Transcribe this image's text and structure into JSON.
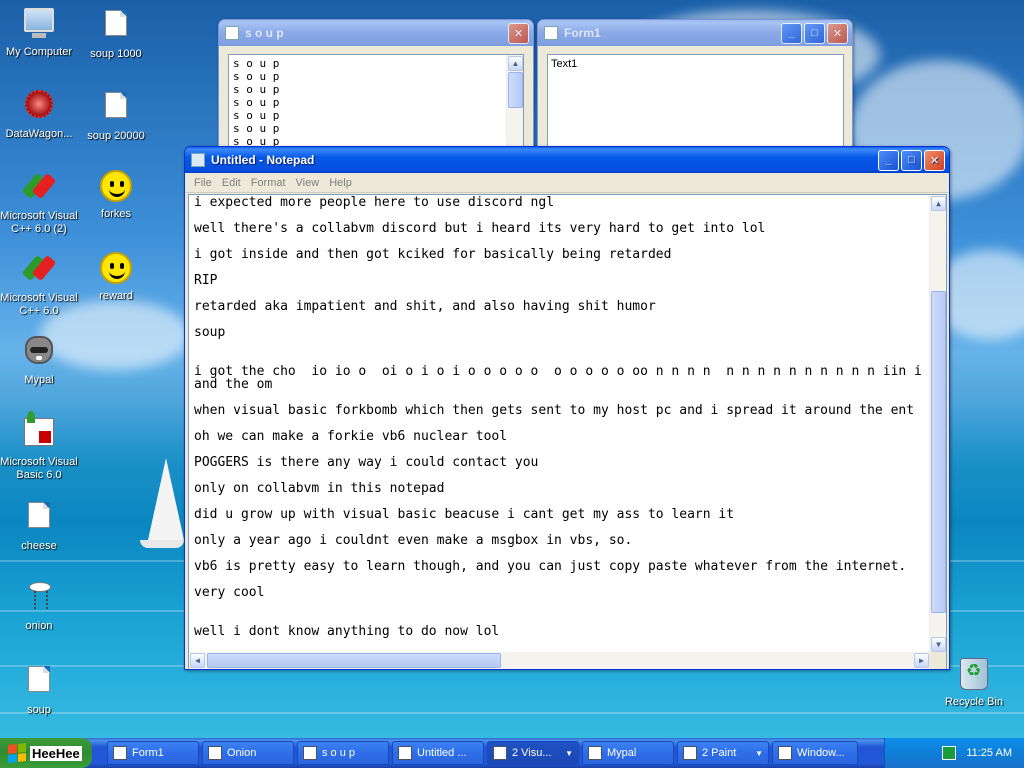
{
  "desktop": {
    "icons": [
      {
        "label": "My Computer",
        "icon": "computer-icon"
      },
      {
        "label": "soup 1000",
        "icon": "file-icon"
      },
      {
        "label": "DataWagon...",
        "icon": "datawagon-icon"
      },
      {
        "label": "soup 20000",
        "icon": "file-icon"
      },
      {
        "label": "Microsoft Visual C++ 6.0 (2)",
        "icon": "visual-cpp-icon"
      },
      {
        "label": "forkes",
        "icon": "smiley-icon"
      },
      {
        "label": "Microsoft Visual C++ 6.0",
        "icon": "visual-cpp-icon"
      },
      {
        "label": "reward",
        "icon": "smiley-icon"
      },
      {
        "label": "Mypal",
        "icon": "raccoon-icon"
      },
      {
        "label": "Microsoft Visual Basic 6.0",
        "icon": "visual-basic-icon"
      },
      {
        "label": "cheese",
        "icon": "file-icon"
      },
      {
        "label": "onion",
        "icon": "onion-icon"
      },
      {
        "label": "soup",
        "icon": "file-icon"
      },
      {
        "label": "Recycle Bin",
        "icon": "recycle-bin-icon"
      }
    ]
  },
  "soup_window": {
    "title": "s o u p",
    "lines": [
      "s o u p",
      "s o u p",
      "s o u p",
      "s o u p",
      "s o u p",
      "s o u p",
      "s o u p"
    ]
  },
  "form1_window": {
    "title": "Form1",
    "textbox_value": "Text1"
  },
  "notepad": {
    "title": "Untitled - Notepad",
    "menu": [
      "File",
      "Edit",
      "Format",
      "View",
      "Help"
    ],
    "lines": [
      "i expected more people here to use discord ngl",
      "well there's a collabvm discord but i heard its very hard to get into lol",
      "i got inside and then got kciked for basically being retarded",
      "RIP",
      "retarded aka impatient and shit, and also having shit humor",
      "soup",
      "i got the cho  io io o  oi o i o i o o o o o  o o o o o oo n n n n  n n n n n n n n n n iin i",
      "and the om",
      "when visual basic forkbomb which then gets sent to my host pc and i spread it around the ent",
      "oh we can make a forkie vb6 nuclear tool",
      "POGGERS is there any way i could contact you",
      "only on collabvm in this notepad",
      "did u grow up with visual basic beacuse i cant get my ass to learn it",
      "only a year ago i couldnt even make a msgbox in vbs, so.",
      "vb6 is pretty easy to learn though, and you can just copy paste whatever from the internet.",
      "very cool",
      "well i dont know anything to do now lol"
    ]
  },
  "taskbar": {
    "start_label": "HeeHee",
    "tasks": [
      {
        "label": "Form1",
        "icon": "form-icon"
      },
      {
        "label": "Onion",
        "icon": "onion-icon"
      },
      {
        "label": "s o u p",
        "icon": "form-icon"
      },
      {
        "label": "Untitled ...",
        "icon": "notepad-icon"
      },
      {
        "label": "2 Visu...",
        "icon": "visual-basic-icon"
      },
      {
        "label": "Mypal",
        "icon": "raccoon-icon"
      },
      {
        "label": "2 Paint",
        "icon": "paint-icon"
      },
      {
        "label": "Window...",
        "icon": "window-icon"
      }
    ],
    "clock": "11:25 AM"
  }
}
